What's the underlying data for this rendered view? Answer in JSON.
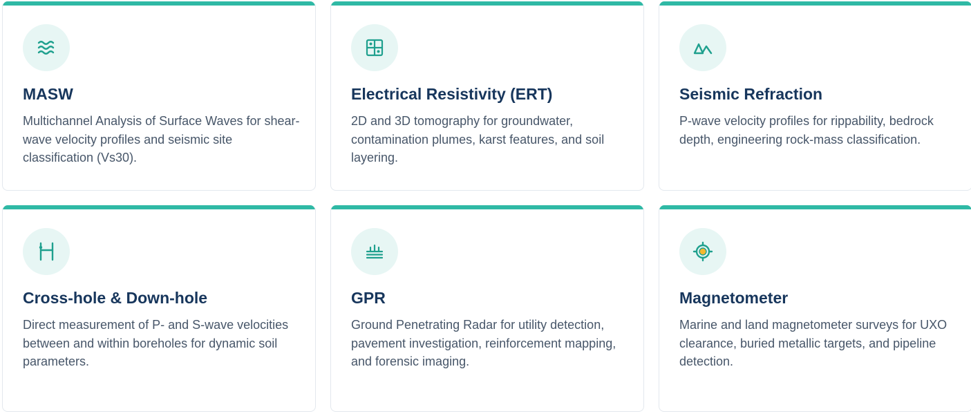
{
  "colors": {
    "accent": "#2fb9a5",
    "icon_bg": "#e7f6f4",
    "title": "#17365c",
    "text": "#475669",
    "marker": "#f5b82e"
  },
  "cards": [
    {
      "icon": "waves-icon",
      "title": "MASW",
      "description": "Multichannel Analysis of Surface Waves for shear-wave velocity profiles and seismic site classification (Vs30)."
    },
    {
      "icon": "grid-icon",
      "title": "Electrical Resistivity (ERT)",
      "description": "2D and 3D tomography for groundwater, contamination plumes, karst features, and soil layering."
    },
    {
      "icon": "peaks-icon",
      "title": "Seismic Refraction",
      "description": "P-wave velocity profiles for rippability, bedrock depth, engineering rock-mass classification."
    },
    {
      "icon": "borehole-icon",
      "title": "Cross-hole & Down-hole",
      "description": "Direct measurement of P- and S-wave velocities between and within boreholes for dynamic soil parameters."
    },
    {
      "icon": "radar-layers-icon",
      "title": "GPR",
      "description": "Ground Penetrating Radar for utility detection, pavement investigation, reinforcement mapping, and forensic imaging."
    },
    {
      "icon": "target-icon",
      "title": "Magnetometer",
      "description": "Marine and land magnetometer surveys for UXO clearance, buried metallic targets, and pipeline detection."
    }
  ]
}
